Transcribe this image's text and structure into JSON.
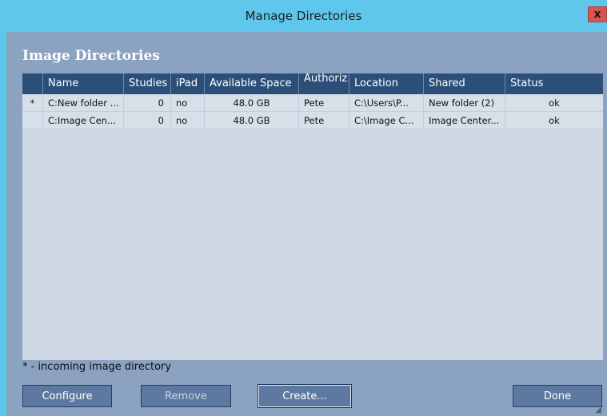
{
  "window": {
    "title": "Manage Directories",
    "close_label": "x"
  },
  "section_title": "Image Directories",
  "columns": [
    "",
    "Name",
    "Studies",
    "iPad",
    "Available Space",
    "Authoriz...",
    "Location",
    "Shared",
    "Status"
  ],
  "rows": [
    {
      "marker": "*",
      "name": "C:New folder ...",
      "studies": "0",
      "ipad": "no",
      "space": "48.0 GB",
      "authorized": "Pete",
      "location": "C:\\Users\\P...",
      "shared": "New folder (2)",
      "status": "ok"
    },
    {
      "marker": "",
      "name": "C:Image Cen...",
      "studies": "0",
      "ipad": "no",
      "space": "48.0 GB",
      "authorized": "Pete",
      "location": "C:\\Image C...",
      "shared": "Image Center...",
      "status": "ok"
    }
  ],
  "footnote": "* - incoming image directory",
  "buttons": {
    "configure": "Configure",
    "remove": "Remove",
    "create": "Create...",
    "done": "Done"
  },
  "colors": {
    "titlebar": "#5fc7ec",
    "client": "#8ba2c1",
    "header": "#2c4f7a",
    "grid": "#ccd7e3",
    "button": "#5e79a1"
  }
}
